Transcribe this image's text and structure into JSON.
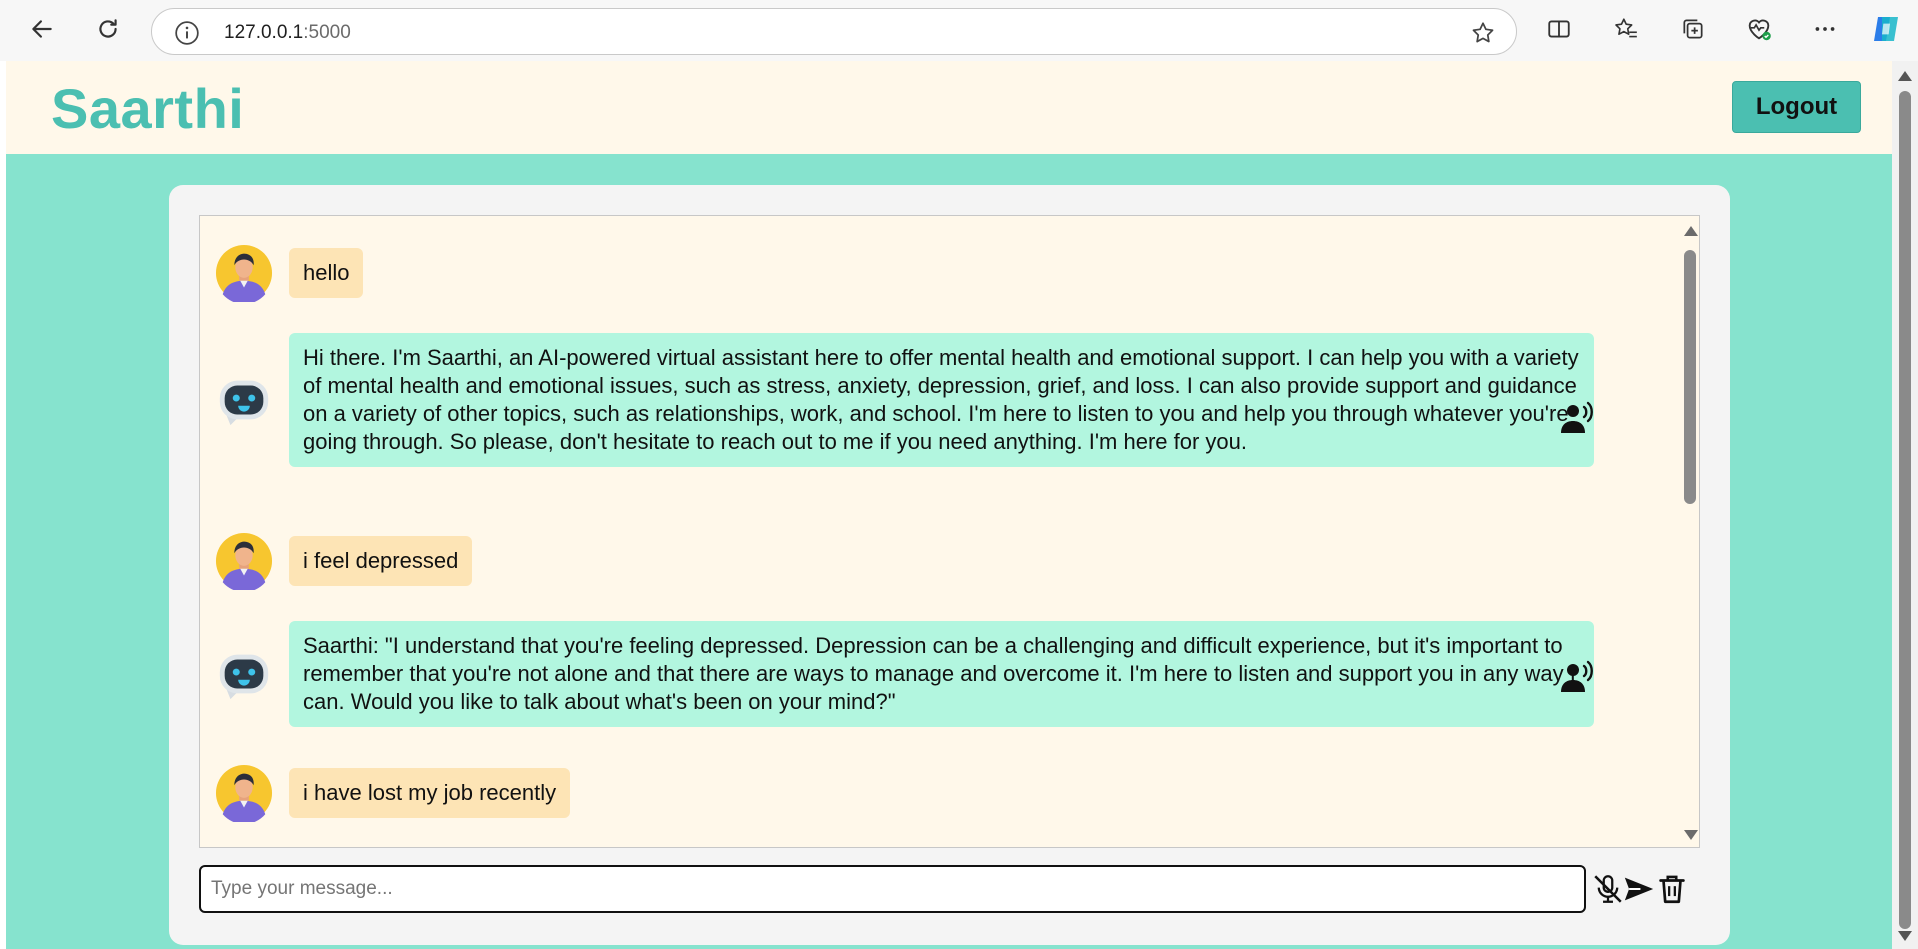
{
  "browser": {
    "url_host": "127.0.0.1",
    "url_port": ":5000"
  },
  "app": {
    "title": "Saarthi",
    "logout_label": "Logout"
  },
  "messages": [
    {
      "sender": "user",
      "text": "hello"
    },
    {
      "sender": "bot",
      "text": "Hi there. I'm Saarthi, an AI-powered virtual assistant here to offer mental health and emotional support. I can help you with a variety of mental health and emotional issues, such as stress, anxiety, depression, grief, and loss. I can also provide support and guidance on a variety of other topics, such as relationships, work, and school. I'm here to listen to you and help you through whatever you're going through. So please, don't hesitate to reach out to me if you need anything. I'm here for you."
    },
    {
      "sender": "user",
      "text": "i feel depressed"
    },
    {
      "sender": "bot",
      "text": "Saarthi: \"I understand that you're feeling depressed. Depression can be a challenging and difficult experience, but it's important to remember that you're not alone and that there are ways to manage and overcome it. I'm here to listen and support you in any way I can. Would you like to talk about what's been on your mind?\""
    },
    {
      "sender": "user",
      "text": "i have lost my job recently"
    }
  ],
  "composer": {
    "placeholder": "Type your message...",
    "value": ""
  },
  "icons": {
    "user_avatar": "user-avatar-icon",
    "bot_avatar": "robot-avatar-icon",
    "speak": "text-to-speech-icon",
    "mic_off": "mic-off-icon",
    "send": "send-icon",
    "delete": "trash-icon"
  },
  "colors": {
    "brand": "#4bbfb1",
    "page_bg": "#86e3ce",
    "header_bg": "#fff8ea",
    "user_bubble": "#fde4b5",
    "bot_bubble": "#b2f6df"
  }
}
